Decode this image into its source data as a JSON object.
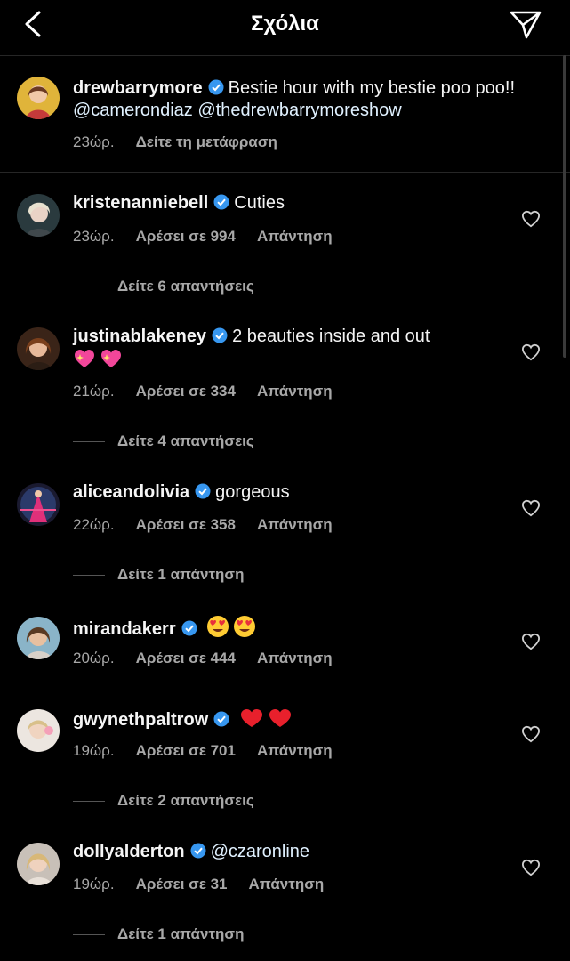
{
  "header": {
    "title": "Σχόλια"
  },
  "caption": {
    "username": "drewbarrymore",
    "text": "Bestie hour with my bestie poo poo!!",
    "mention1": "@camerondiaz",
    "mention2": "@thedrewbarrymoreshow",
    "time": "23ώρ.",
    "translate": "Δείτε τη μετάφραση"
  },
  "comments": [
    {
      "username": "kristenanniebell",
      "text": "Cuties",
      "time": "23ώρ.",
      "likes": "Αρέσει σε 994",
      "reply": "Απάντηση",
      "replies": "Δείτε 6 απαντήσεις"
    },
    {
      "username": "justinablakeney",
      "text": "2 beauties inside and out",
      "time": "21ώρ.",
      "likes": "Αρέσει σε 334",
      "reply": "Απάντηση",
      "replies": "Δείτε 4 απαντήσεις"
    },
    {
      "username": "aliceandolivia",
      "text": "gorgeous",
      "time": "22ώρ.",
      "likes": "Αρέσει σε 358",
      "reply": "Απάντηση",
      "replies": "Δείτε 1 απάντηση"
    },
    {
      "username": "mirandakerr",
      "text": "",
      "time": "20ώρ.",
      "likes": "Αρέσει σε 444",
      "reply": "Απάντηση"
    },
    {
      "username": "gwynethpaltrow",
      "text": "",
      "time": "19ώρ.",
      "likes": "Αρέσει σε 701",
      "reply": "Απάντηση",
      "replies": "Δείτε 2 απαντήσεις"
    },
    {
      "username": "dollyalderton",
      "text": "@czaronline",
      "time": "19ώρ.",
      "likes": "Αρέσει σε 31",
      "reply": "Απάντηση",
      "replies": "Δείτε 1 απάντηση"
    }
  ],
  "icons": {
    "back": "chevron-left-icon",
    "send": "paper-plane-icon",
    "verified": "verified-badge-icon",
    "like": "heart-outline-icon"
  },
  "colors": {
    "background": "#000000",
    "verified": "#3797f0",
    "secondary_text": "#a8a8a8"
  }
}
